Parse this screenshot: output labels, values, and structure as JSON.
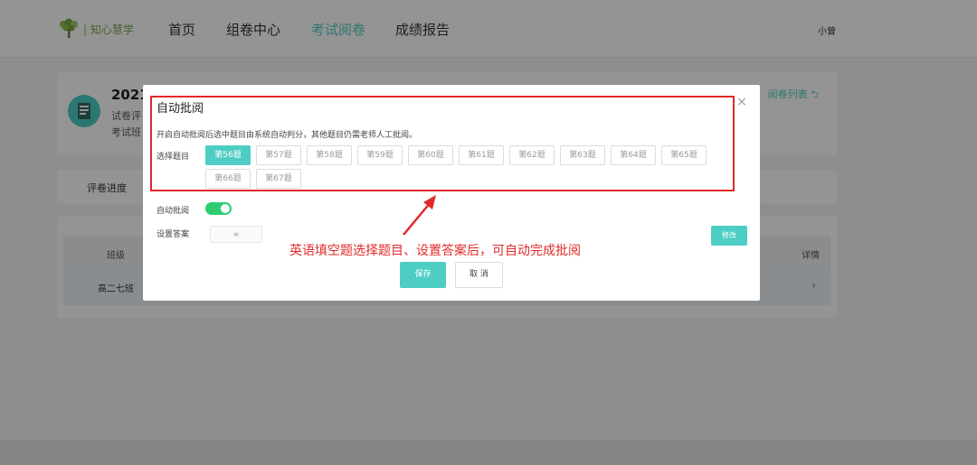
{
  "nav": {
    "logo_text": "| 知心慧学",
    "items": [
      "首页",
      "组卷中心",
      "考试阅卷",
      "成绩报告"
    ],
    "active_index": 2,
    "user": "小曾",
    "accent_color": "#4ecdc4"
  },
  "page": {
    "title": "2021",
    "line1": "试卷评",
    "line2": "考试班",
    "back_link": "阅卷列表 ⮌",
    "tab_progress": "评卷进度",
    "table": {
      "headers": [
        "班级",
        "详情"
      ],
      "rows": [
        {
          "class": "高二七班",
          "detail": "›"
        }
      ]
    }
  },
  "modal": {
    "title": "自动批阅",
    "close": "×",
    "description": "开启自动批阅后选中题目由系统自动判分，其他题目仍需老师人工批阅。",
    "select_label": "选择题目",
    "questions": [
      "第56题",
      "第57题",
      "第58题",
      "第59题",
      "第60题",
      "第61题",
      "第62题",
      "第63题",
      "第64题",
      "第65题",
      "第66题",
      "第67题"
    ],
    "selected_index": 0,
    "auto_label": "自动批阅",
    "auto_on": true,
    "answer_label": "设置答案",
    "answer_value": "≡",
    "modify_label": "修改",
    "save_label": "保存",
    "cancel_label": "取 消",
    "annotation": "英语填空题选择题目、设置答案后，可自动完成批阅",
    "annotation_color": "#e02a2a"
  }
}
